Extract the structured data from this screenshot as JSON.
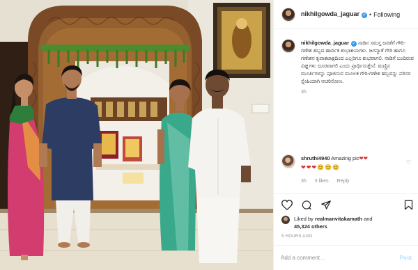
{
  "header": {
    "username": "nikhilgowda_jaguar",
    "verified_mark": "✓",
    "separator": "•",
    "follow_label": "Following"
  },
  "caption": {
    "username": "nikhilgowda_jaguar",
    "verified_mark": "✓",
    "text": "ನಾಡಿನ ಸಮಸ್ತ ಜನತೆಗೆ ಗೌರಿ-ಗಣೇಶ ಹಬ್ಬದ ಹಾರ್ದಿಕ ಶುಭಾಶಯಗಳು. ಜಗನ್ಮಾತೆ ಗೌರಿ ಹಾಗೂ ಗಣೇಶನ ಕೃಪಾಕಟಾಕ್ಷದಿಂದ ಎಲ್ಲರಿಗೂ ಶುಭವಾಗಲಿ. ನಾಡಿಗೆ ಬಂದಿರುವ ವಿಘ್ನಗಳು ದೂರವಾಗಲಿ ಎಂದು ಪ್ರಾರ್ಥಿಸುತ್ತೇನೆ. ಮಣ್ಣಿನ ಮೂರ್ತಿಗಳನ್ನು ಪೂಜಿಸುವ ಮೂಲಕ ಗೌರಿ-ಗಣೇಶ ಹಬ್ಬವನ್ನು ಪರಿಸರ ಸ್ನೇಹಿಯಾಗಿ ಆಚರಿಸೋಣ.",
    "time": "3h"
  },
  "comment": {
    "username": "shruthi4940",
    "text": "Amazing pic",
    "hearts_inline": "❤❤",
    "emoji_hearts": "❤❤❤",
    "emoji_faces": "😊😊😊",
    "time": "3h",
    "likes": "5 likes",
    "reply": "Reply",
    "like_icon": "♡"
  },
  "actions": {
    "icons": [
      "heart-icon",
      "comment-icon",
      "share-icon",
      "save-icon"
    ]
  },
  "likes": {
    "prefix": "Liked by",
    "user": "realmanvitakamath",
    "conj": "and",
    "count": "45,324 others"
  },
  "post_time": "5 HOURS AGO",
  "add_comment": {
    "placeholder": "Add a comment…",
    "post_label": "Post"
  },
  "colors": {
    "accent": "#3897f0",
    "post_disabled": "#b2dffc",
    "muted": "#8e8e8e"
  }
}
